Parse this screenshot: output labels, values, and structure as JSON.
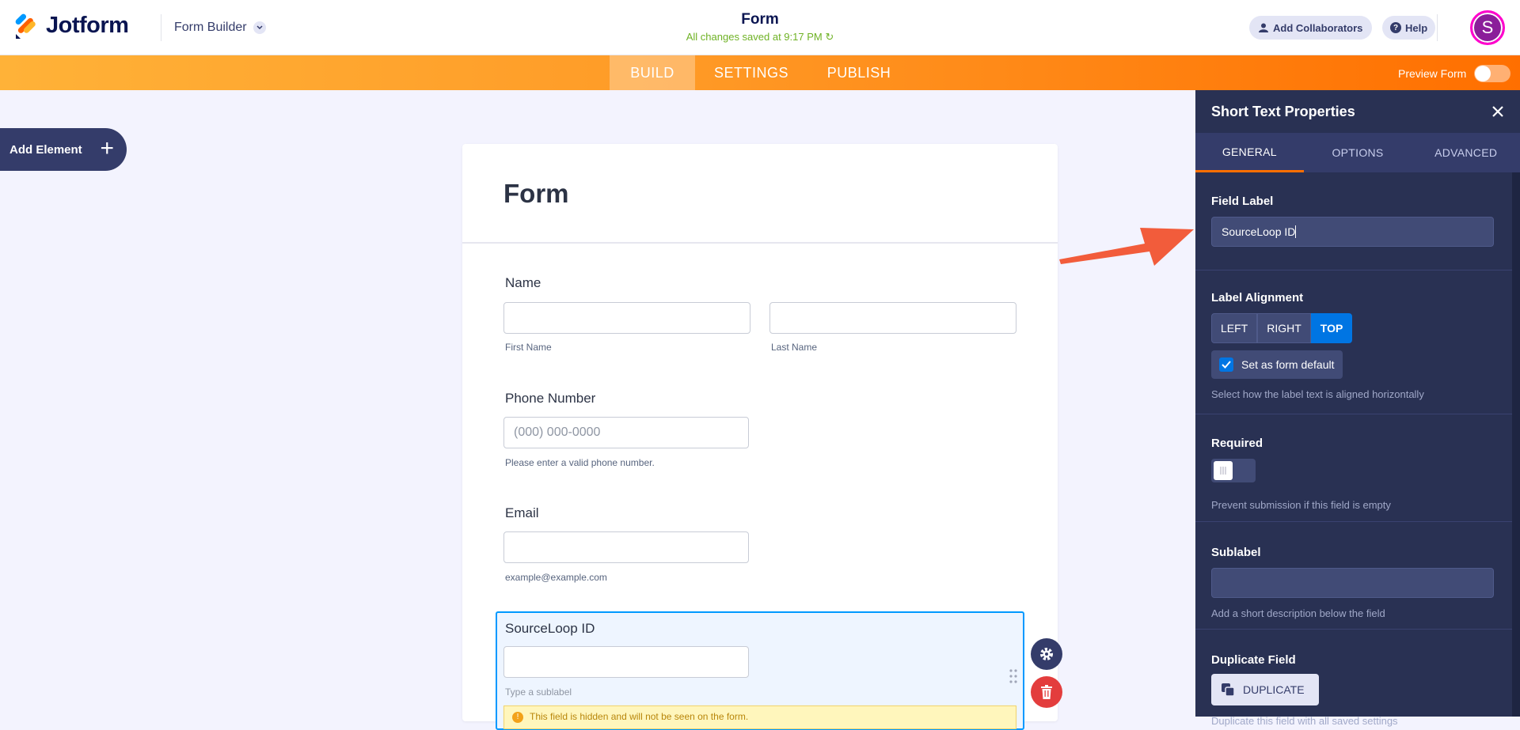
{
  "header": {
    "brand": "Jotform",
    "builder_menu": "Form Builder",
    "form_title": "Form",
    "saved_status": "All changes saved at 9:17 PM",
    "add_collaborators": "Add Collaborators",
    "help": "Help",
    "avatar_initial": "S"
  },
  "nav": {
    "tabs": [
      {
        "label": "BUILD",
        "active": true
      },
      {
        "label": "SETTINGS",
        "active": false
      },
      {
        "label": "PUBLISH",
        "active": false
      }
    ],
    "preview_label": "Preview Form",
    "preview_on": false
  },
  "sidebar": {
    "add_element": "Add Element"
  },
  "form": {
    "title": "Form",
    "name_label": "Name",
    "first_name_sub": "First Name",
    "last_name_sub": "Last Name",
    "phone_label": "Phone Number",
    "phone_placeholder": "(000) 000-0000",
    "phone_sub": "Please enter a valid phone number.",
    "email_label": "Email",
    "email_sub": "example@example.com",
    "selected_label": "SourceLoop ID",
    "selected_sub_placeholder": "Type a sublabel",
    "hidden_warning": "This field is hidden and will not be seen on the form."
  },
  "panel": {
    "title": "Short Text Properties",
    "tabs": [
      "GENERAL",
      "OPTIONS",
      "ADVANCED"
    ],
    "active_tab": "GENERAL",
    "field_label_title": "Field Label",
    "field_label_value": "SourceLoop ID",
    "label_alignment_title": "Label Alignment",
    "alignment_options": [
      "LEFT",
      "RIGHT",
      "TOP"
    ],
    "alignment_selected": "TOP",
    "set_default": "Set as form default",
    "alignment_desc": "Select how the label text is aligned horizontally",
    "required_title": "Required",
    "required_desc": "Prevent submission if this field is empty",
    "sublabel_title": "Sublabel",
    "sublabel_value": "",
    "sublabel_desc": "Add a short description below the field",
    "duplicate_title": "Duplicate Field",
    "duplicate_btn": "DUPLICATE",
    "duplicate_desc": "Duplicate this field with all saved settings"
  },
  "colors": {
    "brand_navy": "#0a1551",
    "accent_orange": "#ff6f00",
    "panel_bg": "#293153",
    "selected_blue": "#0075e3",
    "saved_green": "#6fb225",
    "arrow_red": "#f25c3b"
  }
}
